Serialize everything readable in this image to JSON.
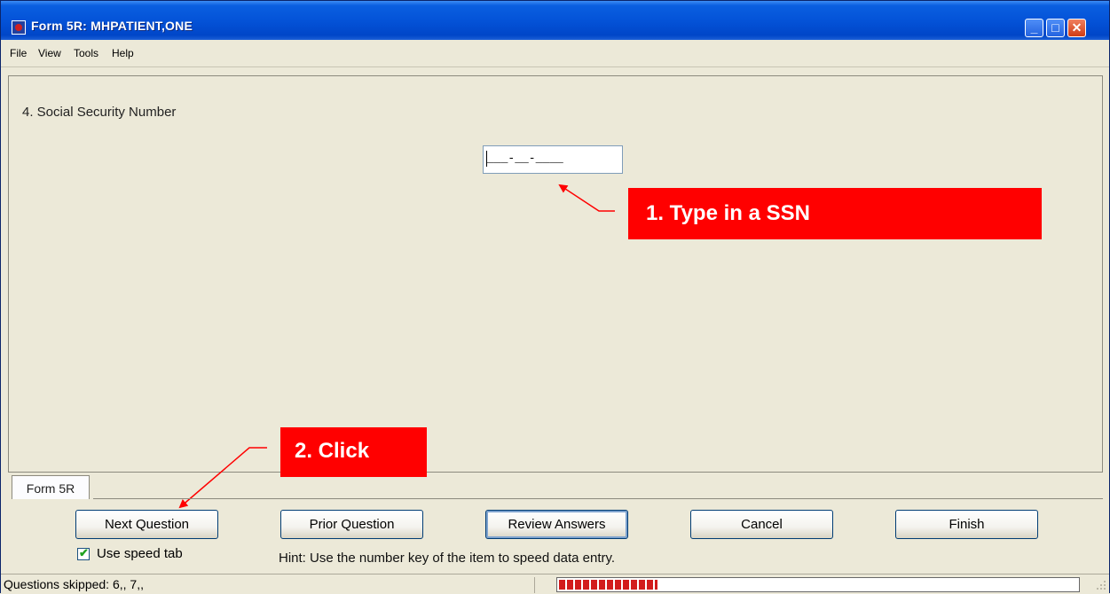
{
  "window": {
    "title": "Form 5R: MHPATIENT,ONE"
  },
  "titlebar_buttons": {
    "minimize": "_",
    "maximize": "□",
    "close": "✕"
  },
  "menu": [
    "File",
    "View",
    "Tools",
    "Help"
  ],
  "question": {
    "label": "4. Social Security Number",
    "mask": "___-__-____"
  },
  "callouts": {
    "type_ssn": "1. Type in a SSN",
    "click": "2. Click"
  },
  "tab": {
    "label": "Form 5R"
  },
  "buttons": {
    "next": "Next Question",
    "prior": "Prior Question",
    "review": "Review Answers",
    "cancel": "Cancel",
    "finish": "Finish"
  },
  "speed_tab": {
    "label": "Use speed tab",
    "checked": true
  },
  "hint": "Hint: Use the number key of the item to speed data entry.",
  "status": {
    "text": "Questions skipped: 6,, 7,,",
    "progress_fraction": 0.19
  },
  "colors": {
    "callout": "#FF0000",
    "progress": "#D21C1C",
    "titlebar": "#0453D8"
  }
}
